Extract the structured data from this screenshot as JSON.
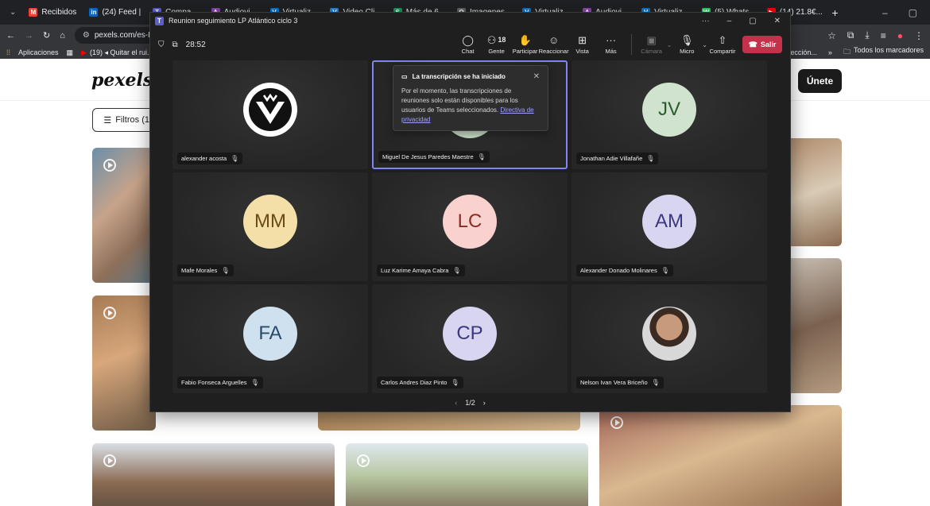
{
  "browser": {
    "tabs": [
      {
        "label": "Recibidos",
        "icon": "gmail-icon",
        "color": "#ea4335",
        "glyph": "M"
      },
      {
        "label": "(24) Feed |",
        "icon": "linkedin-icon",
        "color": "#0a66c2",
        "glyph": "in"
      },
      {
        "label": "Compa...",
        "icon": "teams-icon",
        "color": "#5b5fc7",
        "glyph": "T"
      },
      {
        "label": "Audiovi...",
        "icon": "app-icon",
        "color": "#8e44ad",
        "glyph": "A"
      },
      {
        "label": "Virtualiz...",
        "icon": "app-icon",
        "color": "#0078d4",
        "glyph": "V"
      },
      {
        "label": "Video Cli...",
        "icon": "app-icon",
        "color": "#1e88e5",
        "glyph": "V"
      },
      {
        "label": "Más de 6...",
        "icon": "sheets-icon",
        "color": "#0f9d58",
        "glyph": "S"
      },
      {
        "label": "Imagenes...",
        "icon": "search-icon",
        "color": "#5f6368",
        "glyph": "Q"
      },
      {
        "label": "Virtualiz...",
        "icon": "app-icon",
        "color": "#0078d4",
        "glyph": "V"
      },
      {
        "label": "Audiovi...",
        "icon": "app-icon",
        "color": "#8e44ad",
        "glyph": "A"
      },
      {
        "label": "Virtualiz...",
        "icon": "app-icon",
        "color": "#0078d4",
        "glyph": "V"
      },
      {
        "label": "(5) Whats...",
        "icon": "whatsapp-icon",
        "color": "#25d366",
        "glyph": "W"
      },
      {
        "label": "(14) 21.8€...",
        "icon": "youtube-icon",
        "color": "#ff0000",
        "glyph": "▶"
      }
    ],
    "new_tab": "+",
    "url": "pexels.com/es-ES...",
    "bookmarks": {
      "apps_label": "Aplicaciones",
      "item1": "(19) ◂ Quitar el rui...",
      "right_item": "orrección...",
      "all_bookmarks": "Todos los marcadores"
    }
  },
  "pexels": {
    "logo": "pexels",
    "join_label": "Únete",
    "filters_label": "Filtros (1)"
  },
  "teams": {
    "window_title": "Reunion seguimiento LP Atlántico ciclo 3",
    "elapsed": "28:52",
    "toolbar": {
      "chat": "Chat",
      "people": "Gente",
      "people_count": "18",
      "participate": "Participar",
      "react": "Reaccionar",
      "view": "Vista",
      "more": "Más",
      "camera": "Cámara",
      "mic": "Micro",
      "share": "Compartir",
      "leave": "Salir"
    },
    "transcript_notice": {
      "title": "La transcripción se ha iniciado",
      "body": "Por el momento, las transcripciones de reuniones solo están disponibles para los usuarios de Teams seleccionados.",
      "link": "Directiva de privacidad"
    },
    "participants": [
      {
        "name": "alexander acosta",
        "initials": "",
        "kind": "logo"
      },
      {
        "name": "Miguel De Jesus Paredes Maestre",
        "initials": "",
        "kind": "speaking"
      },
      {
        "name": "Jonathan Adie Villafañe",
        "initials": "JV",
        "bg": "#cfe3cf",
        "fg": "#2d5a2d"
      },
      {
        "name": "Mafe Morales",
        "initials": "MM",
        "bg": "#f4dfa9",
        "fg": "#6b4b14"
      },
      {
        "name": "Luz Karime Amaya Cabra",
        "initials": "LC",
        "bg": "#f9d1cf",
        "fg": "#8a2c23"
      },
      {
        "name": "Alexander Donado Molinares",
        "initials": "AM",
        "bg": "#d7d5ef",
        "fg": "#3b3780"
      },
      {
        "name": "Fabio Fonseca Arguelles",
        "initials": "FA",
        "bg": "#cfe0ee",
        "fg": "#284b6b"
      },
      {
        "name": "Carlos Andres Diaz Pinto",
        "initials": "CP",
        "bg": "#d7d5ef",
        "fg": "#3b3780"
      },
      {
        "name": "Nelson Ivan Vera Briceño",
        "initials": "",
        "kind": "photo"
      }
    ],
    "pager": "1/2"
  }
}
